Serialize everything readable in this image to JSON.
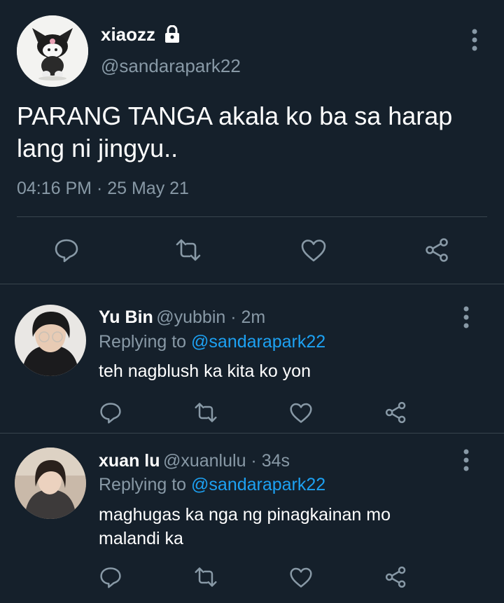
{
  "main_tweet": {
    "display_name": "xiaozz",
    "handle": "@sandarapark22",
    "text_line1": "PARANG TANGA akala ko ba sa harap",
    "text_line2": "lang ni jingyu..",
    "timestamp": "04:16 PM · 25 May 21",
    "icons": {
      "lock": "lock-icon",
      "reply": "reply-icon",
      "retweet": "retweet-icon",
      "like": "heart-icon",
      "share": "share-icon",
      "more": "more-icon"
    }
  },
  "replies": [
    {
      "display_name": "Yu Bin",
      "handle_time": "@yubbin · 2m",
      "replying_prefix": "Replying to ",
      "replying_to": "@sandarapark22",
      "text_line1": "teh nagblush ka kita ko yon",
      "text_line2": ""
    },
    {
      "display_name": "xuan lu",
      "handle_time": "@xuanlulu · 34s",
      "replying_prefix": "Replying to ",
      "replying_to": "@sandarapark22",
      "text_line1": "maghugas ka nga ng pinagkainan mo",
      "text_line2": "malandi ka"
    }
  ],
  "colors": {
    "background": "#15202b",
    "primary_text": "#ffffff",
    "secondary_text": "#8899a6",
    "mention": "#1da1f2",
    "divider": "#38444d"
  }
}
